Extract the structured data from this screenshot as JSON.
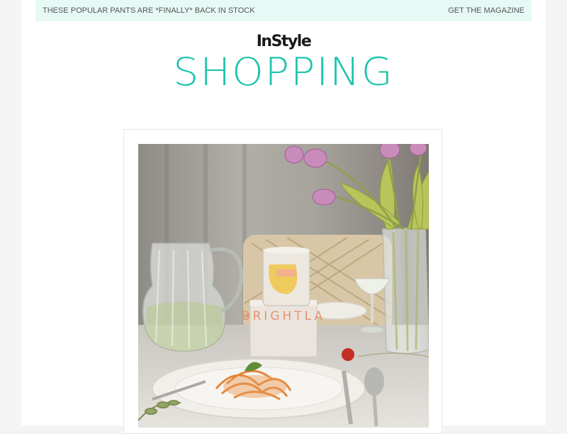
{
  "topbar": {
    "left_text": "THESE POPULAR PANTS ARE *FINALLY* BACK IN STOCK",
    "right_text": "GET THE MAGAZINE"
  },
  "brand": {
    "top": "InStyle",
    "bottom": "SHOPPING",
    "accent_color": "#20c4ad"
  },
  "hero": {
    "box_text": "BRIGHTLA",
    "subject": "table setting with tulips, glass pitcher, candle, box and pasta plate"
  }
}
